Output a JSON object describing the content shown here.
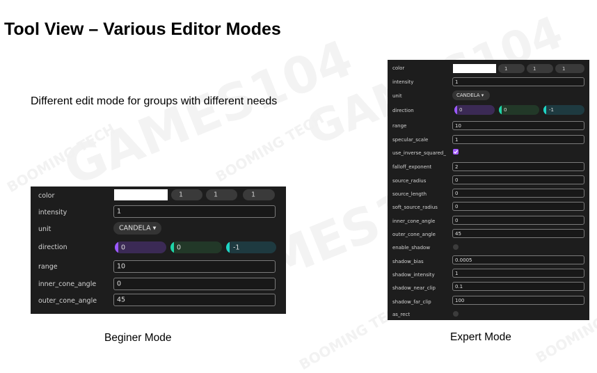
{
  "slide": {
    "title": "Tool View – Various Editor Modes",
    "subtitle": "Different edit mode for groups with different needs",
    "beginner_caption": "Beginer Mode",
    "expert_caption": "Expert Mode"
  },
  "watermark": {
    "games": "GAMES104",
    "booming": "BOOMING TECH"
  },
  "colors": {
    "panel_bg": "#1d1d1d",
    "x_accent": "#9b59ff",
    "y_accent": "#1fd4a8",
    "z_accent": "#1fd4c4",
    "x_track": "#3b2a55",
    "y_track": "#223828",
    "z_track": "#1e3a40",
    "checkbox_on": "#a35cff"
  },
  "beginner": {
    "color_label": "color",
    "color_values": [
      "1",
      "1",
      "1"
    ],
    "intensity_label": "intensity",
    "intensity_value": "1",
    "unit_label": "unit",
    "unit_value": "CANDELA ▾",
    "direction_label": "direction",
    "direction_values": [
      "0",
      "0",
      "-1"
    ],
    "range_label": "range",
    "range_value": "10",
    "inner_cone_angle_label": "inner_cone_angle",
    "inner_cone_angle_value": "0",
    "outer_cone_angle_label": "outer_cone_angle",
    "outer_cone_angle_value": "45"
  },
  "expert": {
    "color_label": "color",
    "color_values": [
      "1",
      "1",
      "1"
    ],
    "intensity_label": "intensity",
    "intensity_value": "1",
    "unit_label": "unit",
    "unit_value": "CANDELA ▾",
    "direction_label": "direction",
    "direction_values": [
      "0",
      "0",
      "-1"
    ],
    "range_label": "range",
    "range_value": "10",
    "specular_scale_label": "specular_scale",
    "specular_scale_value": "1",
    "use_inverse_squared_label": "use_inverse_squared_",
    "use_inverse_squared_checked": true,
    "falloff_exponent_label": "falloff_exponent",
    "falloff_exponent_value": "2",
    "source_radius_label": "source_radius",
    "source_radius_value": "0",
    "source_length_label": "source_length",
    "source_length_value": "0",
    "soft_source_radius_label": "soft_source_radius",
    "soft_source_radius_value": "0",
    "inner_cone_angle_label": "inner_cone_angle",
    "inner_cone_angle_value": "0",
    "outer_cone_angle_label": "outer_cone_angle",
    "outer_cone_angle_value": "45",
    "enable_shadow_label": "enable_shadow",
    "enable_shadow_checked": false,
    "shadow_bias_label": "shadow_bias",
    "shadow_bias_value": "0.0005",
    "shadow_intensity_label": "shadow_intensity",
    "shadow_intensity_value": "1",
    "shadow_near_clip_label": "shadow_near_clip",
    "shadow_near_clip_value": "0.1",
    "shadow_far_clip_label": "shadow_far_clip",
    "shadow_far_clip_value": "100",
    "as_rect_label": "as_rect",
    "as_rect_checked": false
  }
}
